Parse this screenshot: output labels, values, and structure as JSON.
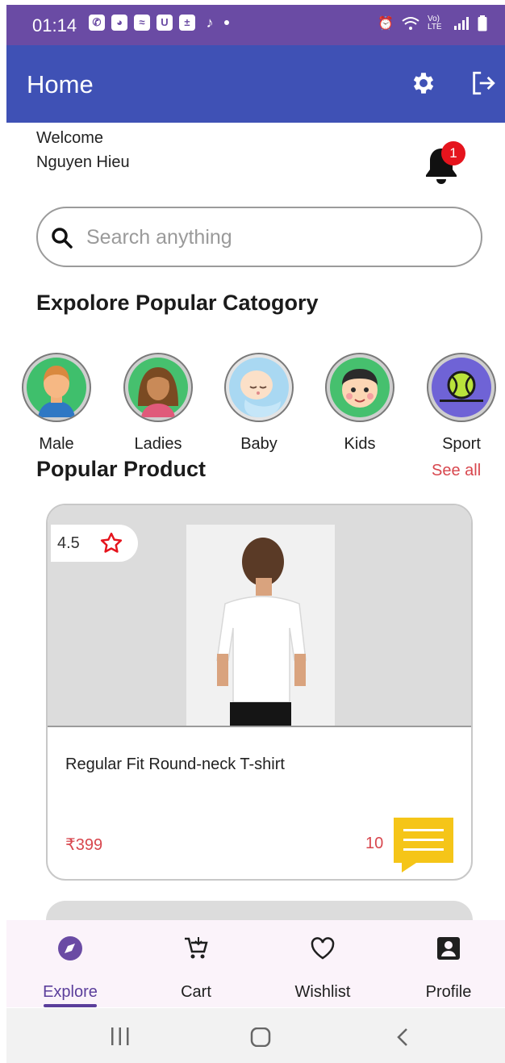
{
  "status_bar": {
    "time": "01:14",
    "notification_icons": [
      "whatsapp-icon",
      "discord-icon",
      "messenger-icon",
      "u-app-icon",
      "calculator-icon",
      "tiktok-icon",
      "dot-icon"
    ],
    "system_icons": [
      "alarm-icon",
      "wifi-icon",
      "volte-icon",
      "signal-icon",
      "battery-icon"
    ],
    "volte_text": "Vo) LTE"
  },
  "app_bar": {
    "title": "Home",
    "actions": [
      "settings-icon",
      "logout-icon"
    ],
    "color": "#3f51b5"
  },
  "welcome": {
    "greeting": "Welcome",
    "user_name": "Nguyen Hieu",
    "notification_count": "1"
  },
  "search": {
    "placeholder": "Search anything",
    "value": ""
  },
  "categories_section": {
    "title": "Expolore Popular Catogory",
    "items": [
      {
        "label": "Male",
        "icon": "male-avatar-icon"
      },
      {
        "label": "Ladies",
        "icon": "female-avatar-icon"
      },
      {
        "label": "Baby",
        "icon": "baby-avatar-icon"
      },
      {
        "label": "Kids",
        "icon": "kid-avatar-icon"
      },
      {
        "label": "Sport",
        "icon": "tennis-ball-icon"
      }
    ]
  },
  "popular_section": {
    "title": "Popular Product",
    "see_all": "See all"
  },
  "products": [
    {
      "rating": "4.5",
      "name": "Regular Fit Round-neck T-shirt",
      "price": "₹399",
      "comment_count": "10"
    }
  ],
  "bottom_nav": {
    "items": [
      {
        "label": "Explore",
        "icon": "compass-icon",
        "active": true
      },
      {
        "label": "Cart",
        "icon": "cart-icon",
        "active": false
      },
      {
        "label": "Wishlist",
        "icon": "heart-icon",
        "active": false
      },
      {
        "label": "Profile",
        "icon": "profile-icon",
        "active": false
      }
    ]
  },
  "colors": {
    "status_bar": "#6a4ba4",
    "accent_red": "#d8474e",
    "nav_active": "#5b3e9b",
    "chat_yellow": "#f5c518"
  }
}
